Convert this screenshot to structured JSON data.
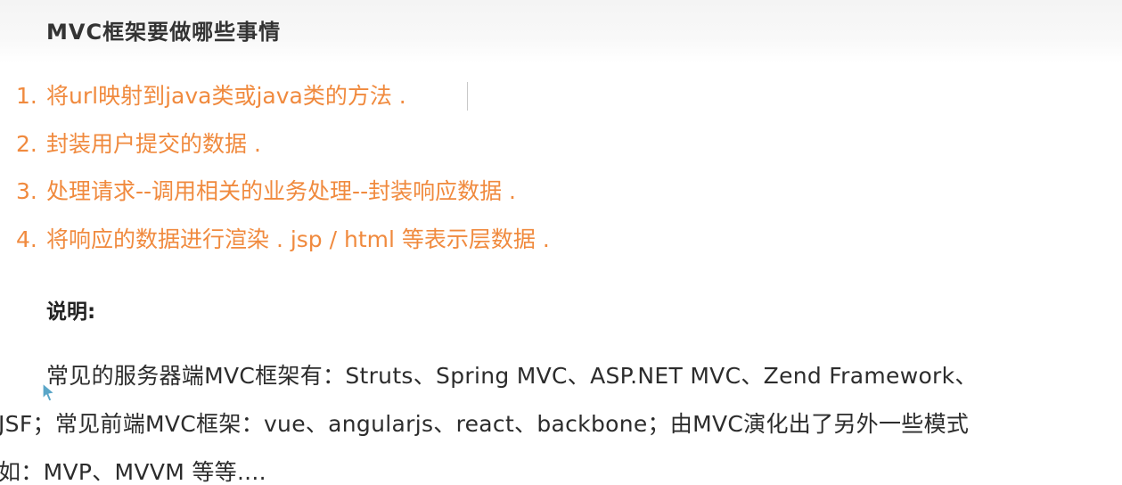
{
  "document": {
    "title": "MVC框架要做哪些事情",
    "steps": [
      {
        "num": "1.",
        "text": "将url映射到java类或java类的方法 ."
      },
      {
        "num": "2.",
        "text": "封装用户提交的数据 ."
      },
      {
        "num": "3.",
        "text": "处理请求--调用相关的业务处理--封装响应数据 ."
      },
      {
        "num": "4.",
        "text": "将响应的数据进行渲染 . jsp / html 等表示层数据 ."
      }
    ],
    "note_heading": "说明:",
    "paragraph_lines": [
      "常见的服务器端MVC框架有：Struts、Spring MVC、ASP.NET MVC、Zend Framework、",
      "JSF；常见前端MVC框架：vue、angularjs、react、backbone；由MVC演化出了另外一些模式",
      "如：MVP、MVVM 等等...."
    ]
  },
  "colors": {
    "title": "#333333",
    "list_text": "#f08a3e",
    "body_text": "#2c2c2c",
    "cursor": "#5aa6c8"
  },
  "icons": {
    "cursor": "mouse-pointer-icon"
  }
}
